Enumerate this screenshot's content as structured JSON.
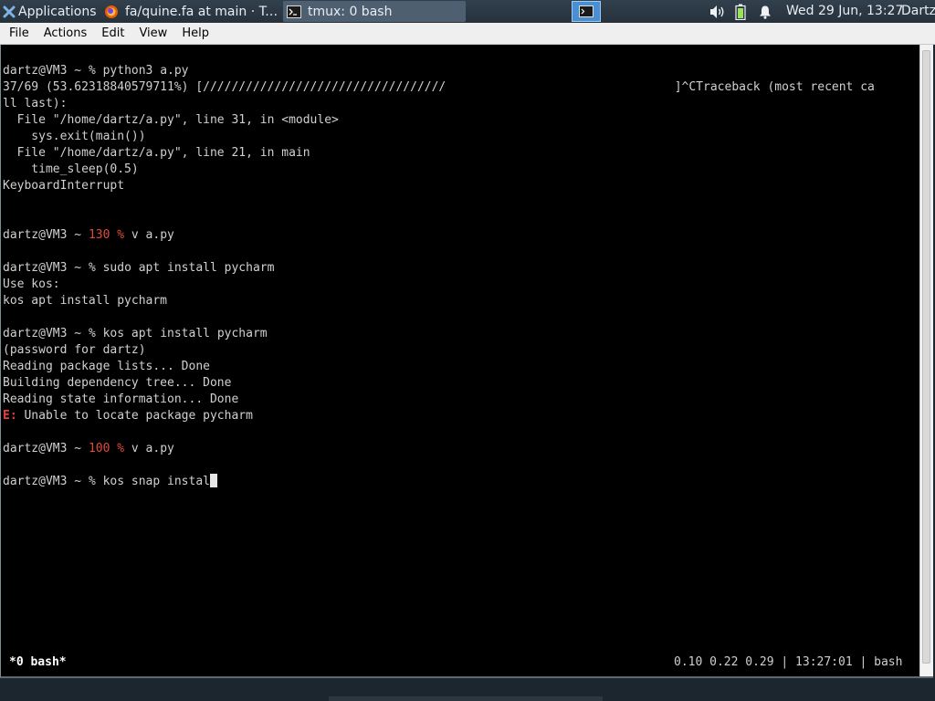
{
  "panel": {
    "apps_label": "Applications",
    "tasks": [
      {
        "label": "fa/quine.fa at main · Tru..."
      },
      {
        "label": "tmux: 0 bash"
      }
    ],
    "clock": "Wed 29 Jun, 13:27",
    "user": "Dartz"
  },
  "menu": [
    "File",
    "Actions",
    "Edit",
    "View",
    "Help"
  ],
  "terminal": {
    "prompt_user": "dartz",
    "prompt_host": "@VM3",
    "prompt_sep": " ~ ",
    "lines": {
      "l1_cmd": "% python3 a.py",
      "l2": "37/69 (53.62318840579711%) [//////////////////////////////////                                ]^CTraceback (most recent ca",
      "l3": "ll last):",
      "l4": "  File \"/home/dartz/a.py\", line 31, in <module>",
      "l5": "    sys.exit(main())",
      "l6": "  File \"/home/dartz/a.py\", line 21, in main",
      "l7": "    time_sleep(0.5)",
      "l8": "KeyboardInterrupt",
      "l9_code": "130 %",
      "l9_cmd": " v a.py",
      "l10_cmd": "% sudo apt install pycharm",
      "l11": "Use kos:",
      "l12": "kos apt install pycharm",
      "l13_cmd": "% kos apt install pycharm",
      "l14": "(password for dartz)",
      "l15": "Reading package lists... Done",
      "l16": "Building dependency tree... Done",
      "l17": "Reading state information... Done",
      "l18_err": "E:",
      "l18_msg": " Unable to locate package pycharm",
      "l19_code": "100 %",
      "l19_cmd": " v a.py",
      "l20_cmd": "% kos snap instal"
    }
  },
  "tmux": {
    "window": "*0 bash*",
    "status": "0.10 0.22 0.29 | 13:27:01 | bash"
  },
  "colors": {
    "accent": "#4a8fd2",
    "error": "#ef3a3a",
    "exit_code": "#e04a3a"
  },
  "icons": [
    "xfce-icon",
    "firefox-icon",
    "terminal-icon",
    "volume-icon",
    "battery-icon",
    "bell-icon"
  ]
}
